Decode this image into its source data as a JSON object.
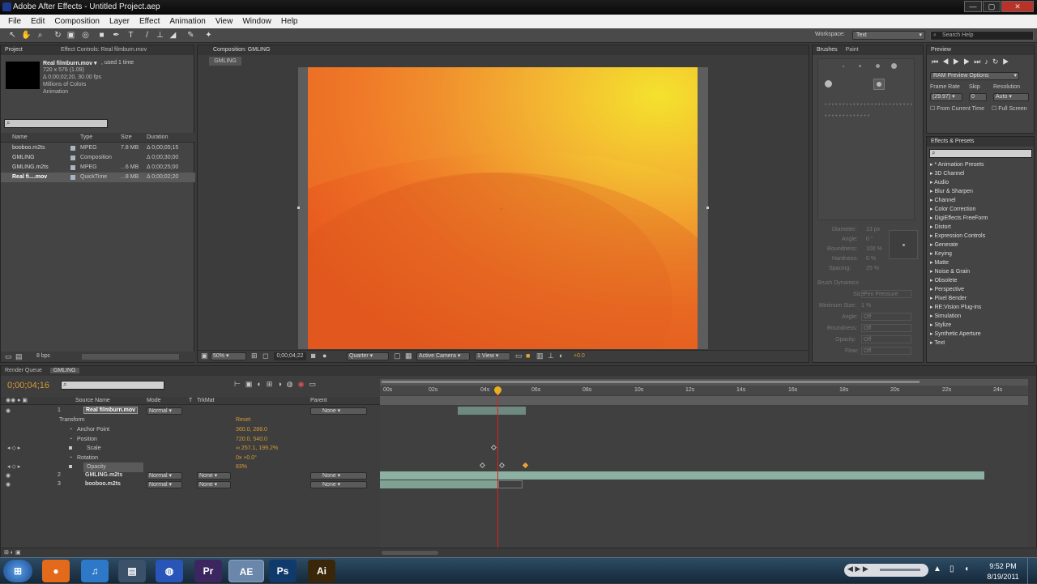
{
  "window": {
    "title": "Adobe After Effects - Untitled Project.aep",
    "min": "—",
    "max": "▢",
    "close": "✕"
  },
  "menu": [
    "File",
    "Edit",
    "Composition",
    "Layer",
    "Effect",
    "Animation",
    "View",
    "Window",
    "Help"
  ],
  "toolbar": {
    "workspace_label": "Workspace:",
    "workspace_value": "Text",
    "search_placeholder": "Search Help"
  },
  "project": {
    "tabs": [
      "Project",
      "Effect Controls: Real filmburn.mov"
    ],
    "selected_name": "Real filmburn.mov ▾",
    "selected_used": ", used 1 time",
    "selected_info": [
      "720 x 576 (1.09)",
      "Δ 0;00;02;20, 30.00 fps",
      "Millions of Colors",
      "Animation"
    ],
    "columns": [
      "Name",
      "Type",
      "Size",
      "Duration"
    ],
    "items": [
      {
        "name": "booboo.m2ts",
        "type": "MPEG",
        "size": "7.8 MB",
        "duration": "Δ 0;00;05;15"
      },
      {
        "name": "GMLING",
        "type": "Composition",
        "size": "",
        "duration": "Δ 0;00;30;00"
      },
      {
        "name": "GMLING.m2ts",
        "type": "MPEG",
        "size": "...6 MB",
        "duration": "Δ 0;00;25;00"
      },
      {
        "name": "Real fi....mov",
        "type": "QuickTime",
        "size": "...8 MB",
        "duration": "Δ 0;00;02;20"
      }
    ],
    "bpc": "8 bpc"
  },
  "composition": {
    "tab": "Composition: GMLING",
    "subtab": "GMLING",
    "zoom": "50%",
    "timecode": "0;00;04;22",
    "resolution": "Quarter",
    "camera": "Active Camera",
    "view": "1 View",
    "exposure": "+0.0"
  },
  "brushes": {
    "tabs": [
      "Brushes",
      "Paint"
    ],
    "props": [
      {
        "label": "Diameter:",
        "value": "13 px"
      },
      {
        "label": "Angle:",
        "value": "0 °"
      },
      {
        "label": "Roundness:",
        "value": "100 %"
      },
      {
        "label": "Hardness:",
        "value": "0 %"
      },
      {
        "label": "Spacing:",
        "value": "25 %"
      }
    ],
    "dynamics_title": "Brush Dynamics",
    "dynamics": [
      {
        "label": "Size:",
        "value": "Pen Pressure"
      },
      {
        "label": "Minimum Size:",
        "value": "1 %"
      },
      {
        "label": "Angle:",
        "value": "Off"
      },
      {
        "label": "Roundness:",
        "value": "Off"
      },
      {
        "label": "Opacity:",
        "value": "Off"
      },
      {
        "label": "Flow:",
        "value": "Off"
      }
    ],
    "sizes": [
      "1",
      "3",
      "5",
      "9",
      "13",
      "19",
      "5",
      "9",
      "13",
      "17",
      "21",
      "27",
      "35",
      "45",
      "65",
      "100",
      "200",
      "300"
    ]
  },
  "preview": {
    "tab": "Preview",
    "ram_options": "RAM Preview Options",
    "frame_rate_label": "Frame Rate",
    "skip_label": "Skip",
    "resolution_label": "Resolution",
    "frame_rate": "(29.97)",
    "skip": "0",
    "resolution": "Auto",
    "from_current": "From Current Time",
    "full_screen": "Full Screen"
  },
  "effects": {
    "tab": "Effects & Presets",
    "items": [
      "* Animation Presets",
      "3D Channel",
      "Audio",
      "Blur & Sharpen",
      "Channel",
      "Color Correction",
      "DigiEffects FreeForm",
      "Distort",
      "Expression Controls",
      "Generate",
      "Keying",
      "Matte",
      "Noise & Grain",
      "Obsolete",
      "Perspective",
      "Pixel Bender",
      "RE:Vision Plug-ins",
      "Simulation",
      "Stylize",
      "Synthetic Aperture",
      "Text"
    ]
  },
  "timeline": {
    "tabs": [
      "Render Queue",
      "GMLING"
    ],
    "timecode": "0;00;04;16",
    "columns": {
      "source": "Source Name",
      "mode": "Mode",
      "t": "T",
      "trkmat": "TrkMat",
      "parent": "Parent"
    },
    "ruler": [
      "00s",
      "02s",
      "04s",
      "06s",
      "08s",
      "10s",
      "12s",
      "14s",
      "16s",
      "18s",
      "20s",
      "22s",
      "24s"
    ],
    "layers": [
      {
        "num": "1",
        "name": "Real filmburn.mov",
        "mode": "Normal",
        "trk": "",
        "parent": "None"
      },
      {
        "num": "2",
        "name": "GMLING.m2ts",
        "mode": "Normal",
        "trk": "None",
        "parent": "None"
      },
      {
        "num": "3",
        "name": "booboo.m2ts",
        "mode": "Normal",
        "trk": "None",
        "parent": "None"
      }
    ],
    "transform": {
      "label": "Transform",
      "reset": "Reset",
      "props": [
        {
          "name": "Anchor Point",
          "value": "360.0, 288.0"
        },
        {
          "name": "Position",
          "value": "720.0, 540.0"
        },
        {
          "name": "Scale",
          "value": "∞ 257.1, 199.2%"
        },
        {
          "name": "Rotation",
          "value": "0x +0.0°"
        },
        {
          "name": "Opacity",
          "value": "83%"
        }
      ]
    }
  },
  "taskbar": {
    "time": "9:52 PM",
    "date": "8/19/2011",
    "apps": [
      {
        "name": "start",
        "label": "⊞",
        "color": "#2a7bd4"
      },
      {
        "name": "firefox",
        "label": "●",
        "color": "#e36a1b"
      },
      {
        "name": "itunes",
        "label": "♫",
        "color": "#2d79c7"
      },
      {
        "name": "explorer",
        "label": "▤",
        "color": "#3a5169"
      },
      {
        "name": "globe",
        "label": "◍",
        "color": "#2a55b8"
      },
      {
        "name": "premiere",
        "label": "Pr",
        "color": "#3c2660"
      },
      {
        "name": "aftereffects",
        "label": "AE",
        "color": "#26325c"
      },
      {
        "name": "photoshop",
        "label": "Ps",
        "color": "#0f3a6b"
      },
      {
        "name": "illustrator",
        "label": "Ai",
        "color": "#3a2608"
      }
    ]
  }
}
